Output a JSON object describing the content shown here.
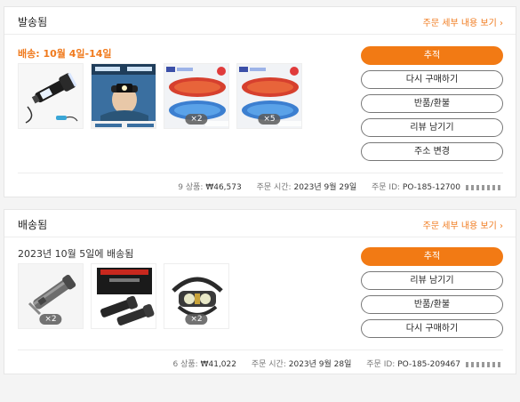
{
  "orders": [
    {
      "status": "발송됨",
      "detail_link": "주문 세부 내용 보기 ›",
      "delivery_text": "배송: 10월 4일-14일",
      "items": [
        {
          "name": "flashlight-image",
          "qty": ""
        },
        {
          "name": "headlamp-image",
          "qty": ""
        },
        {
          "name": "insoles-image",
          "qty": "×2"
        },
        {
          "name": "insoles-image-2",
          "qty": "×5"
        }
      ],
      "buttons": [
        "추적",
        "다시 구매하기",
        "반품/환불",
        "리뷰 남기기",
        "주소 변경"
      ],
      "summary": {
        "count": "9 상품:",
        "total": "₩46,573",
        "time_label": "주문 시간:",
        "time": "2023년 9월 29일",
        "id_label": "주문 ID:",
        "id": "PO-185-12700"
      }
    },
    {
      "status": "배송됨",
      "detail_link": "주문 세부 내용 보기 ›",
      "delivery_text": "2023년 10월 5일에 배송됨",
      "items": [
        {
          "name": "multitool-flashlight-image",
          "qty": "×2"
        },
        {
          "name": "tactical-flashlight-set-image",
          "qty": ""
        },
        {
          "name": "headlamp-image-2",
          "qty": "×2"
        }
      ],
      "buttons": [
        "추적",
        "리뷰 남기기",
        "반품/환불",
        "다시 구매하기"
      ],
      "summary": {
        "count": "6 상품:",
        "total": "₩41,022",
        "time_label": "주문 시간:",
        "time": "2023년 9월 28일",
        "id_label": "주문 ID:",
        "id": "PO-185-209467"
      }
    }
  ]
}
